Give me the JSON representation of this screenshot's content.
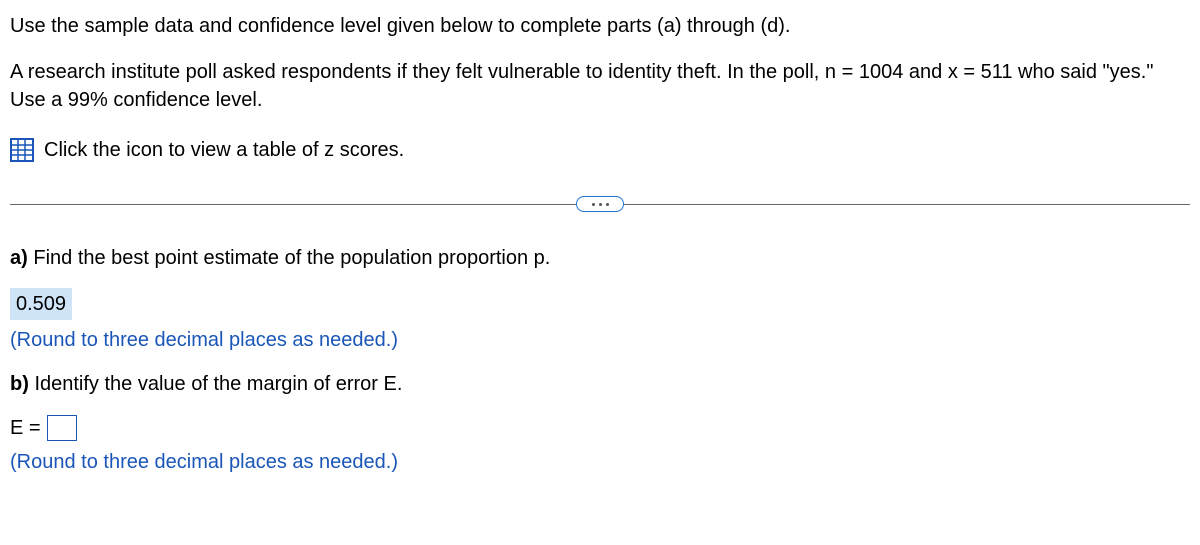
{
  "instruction": "Use the sample data and confidence level given below to complete parts (a) through (d).",
  "context": "A research institute poll asked respondents if they felt vulnerable to identity theft. In the poll, n = 1004 and x = 511 who said \"yes.\" Use a 99% confidence level.",
  "iconLink": "Click the icon to view a table of z scores.",
  "partA": {
    "label": "a)",
    "question": " Find the best point estimate of the population proportion p.",
    "answer": "0.509",
    "hint": "(Round to three decimal places as needed.)"
  },
  "partB": {
    "label": "b)",
    "question": " Identify the value of the margin of error E.",
    "eqLabel": "E =",
    "hint": "(Round to three decimal places as needed.)"
  }
}
